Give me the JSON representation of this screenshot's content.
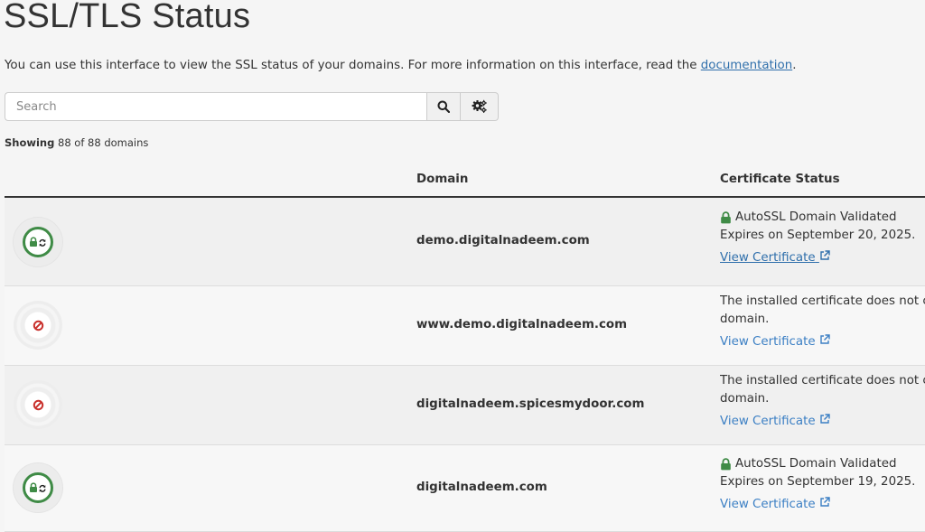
{
  "page": {
    "title": "SSL/TLS Status",
    "intro_text": "You can use this interface to view the SSL status of your domains. For more information on this interface, read the ",
    "intro_link": "documentation",
    "intro_end": "."
  },
  "search": {
    "placeholder": "Search",
    "value": ""
  },
  "summary": {
    "showing_label": "Showing",
    "count_text": "88 of 88 domains"
  },
  "table": {
    "headers": {
      "domain": "Domain",
      "certificate_status": "Certificate Status"
    },
    "rows": [
      {
        "status": "ok",
        "domain": "demo.digitalnadeem.com",
        "cert_line1": "AutoSSL Domain Validated",
        "cert_line2": "Expires on September 20, 2025.",
        "view_label": "View Certificate"
      },
      {
        "status": "not_covered",
        "domain": "www.demo.digitalnadeem.com",
        "cert_line1": "The installed certificate does not cov",
        "cert_line2": "domain.",
        "view_label": "View Certificate"
      },
      {
        "status": "not_covered",
        "domain": "digitalnadeem.spicesmydoor.com",
        "cert_line1": "The installed certificate does not cov",
        "cert_line2": "domain.",
        "view_label": "View Certificate"
      },
      {
        "status": "ok",
        "domain": "digitalnadeem.com",
        "cert_line1": "AutoSSL Domain Validated",
        "cert_line2": "Expires on September 19, 2025.",
        "view_label": "View Certificate"
      }
    ]
  },
  "icons": {
    "search": "search-icon",
    "settings": "gears-icon",
    "lock": "lock-icon",
    "external_link": "external-link-icon",
    "no_entry": "ban-icon"
  },
  "colors": {
    "ok_green": "#3f8b46",
    "ban_red": "#c9302c",
    "link_blue": "#3b7fc4"
  }
}
